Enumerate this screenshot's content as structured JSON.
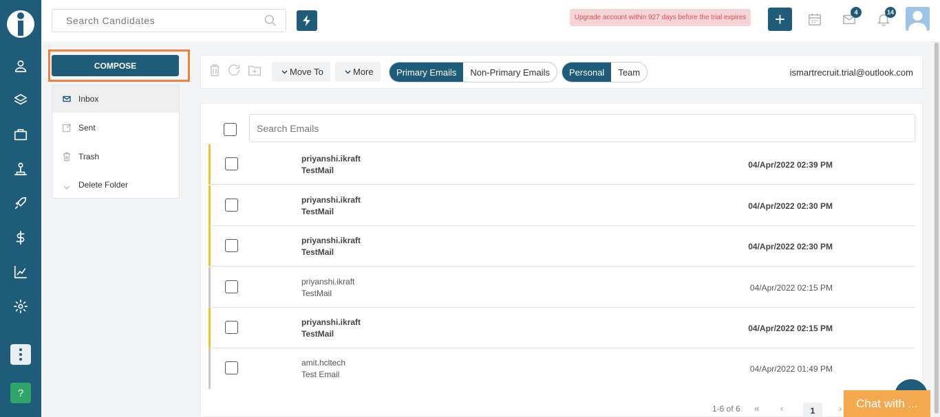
{
  "sidebar": {
    "nav_icons": [
      "user-icon",
      "layers-icon",
      "briefcase-icon",
      "org-chart-icon",
      "rocket-icon",
      "dollar-icon",
      "analytics-icon",
      "gear-icon"
    ],
    "help_label": "?"
  },
  "header": {
    "search_placeholder": "Search Candidates",
    "trial_banner": "Upgrade account within 927 days before the trial expires",
    "add_label": "+",
    "mail_badge": "4",
    "notification_badge": "14"
  },
  "folders": {
    "compose_label": "COMPOSE",
    "items": [
      {
        "label": "Inbox",
        "icon": "inbox-icon",
        "active": true
      },
      {
        "label": "Sent",
        "icon": "sent-icon",
        "active": false
      },
      {
        "label": "Trash",
        "icon": "trash-icon",
        "active": false
      },
      {
        "label": "Delete Folder",
        "icon": "chevron-down-icon",
        "active": false
      }
    ]
  },
  "toolbar": {
    "move_to_label": "Move To",
    "more_label": "More",
    "primary_label": "Primary Emails",
    "non_primary_label": "Non-Primary Emails",
    "personal_label": "Personal",
    "team_label": "Team",
    "account_email": "ismartrecruit.trial@outlook.com"
  },
  "email_list": {
    "search_placeholder": "Search Emails",
    "emails": [
      {
        "from": "priyanshi.ikraft",
        "subject": "TestMail",
        "date": "04/Apr/2022 02:39 PM",
        "unread": true
      },
      {
        "from": "priyanshi.ikraft",
        "subject": "TestMail",
        "date": "04/Apr/2022 02:30 PM",
        "unread": true
      },
      {
        "from": "priyanshi.ikraft",
        "subject": "TestMail",
        "date": "04/Apr/2022 02:30 PM",
        "unread": true
      },
      {
        "from": "priyanshi.ikraft",
        "subject": "TestMail",
        "date": "04/Apr/2022 02:15 PM",
        "unread": false
      },
      {
        "from": "priyanshi.ikraft",
        "subject": "TestMail",
        "date": "04/Apr/2022 02:15 PM",
        "unread": true
      },
      {
        "from": "amit.hcltech",
        "subject": "Test Email",
        "date": "04/Apr/2022 01:49 PM",
        "unread": false
      }
    ]
  },
  "pagination": {
    "summary": "1-6 of 6",
    "first_label": "«",
    "prev_label": "‹",
    "current_page": "1",
    "next_label": "›"
  },
  "chat": {
    "label": "Chat with ..."
  },
  "colors": {
    "primary": "#1f5c7a",
    "highlight": "#f0813a",
    "unread_marker": "#f2c12e",
    "chat": "#f5a94f",
    "help": "#2fa56a"
  }
}
